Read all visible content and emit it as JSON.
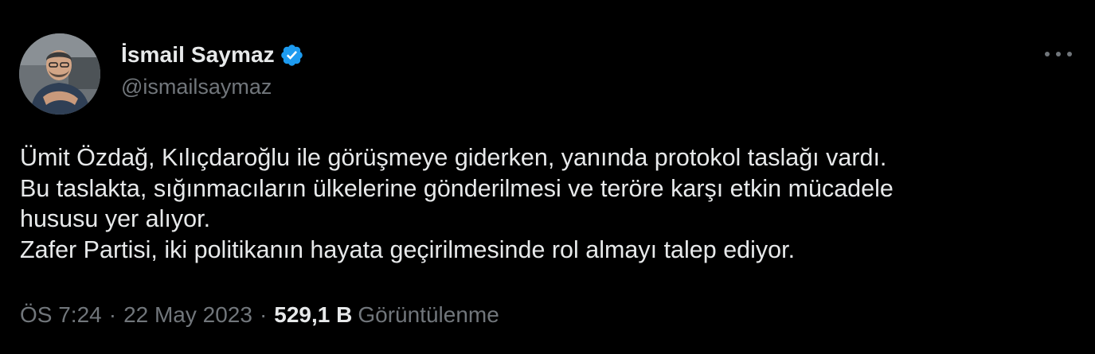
{
  "author": {
    "display_name": "İsmail Saymaz",
    "handle": "@ismailsaymaz",
    "verified": true
  },
  "tweet": {
    "lines": [
      "Ümit Özdağ, Kılıçdaroğlu ile görüşmeye giderken, yanında protokol taslağı vardı.",
      "Bu taslakta, sığınmacıların ülkelerine gönderilmesi ve teröre karşı etkin mücadele",
      "hususu yer alıyor.",
      "Zafer Partisi, iki politikanın hayata geçirilmesinde rol almayı talep ediyor."
    ]
  },
  "meta": {
    "time": "ÖS 7:24",
    "separator": "·",
    "date": "22 May 2023",
    "views_count": "529,1 B",
    "views_label": "Görüntülenme"
  },
  "icons": {
    "verified": "verified-badge-icon",
    "more": "more-options-icon"
  },
  "colors": {
    "background": "#000000",
    "primary_text": "#e7e9ea",
    "secondary_text": "#71767b",
    "verified_blue": "#1d9bf0"
  }
}
